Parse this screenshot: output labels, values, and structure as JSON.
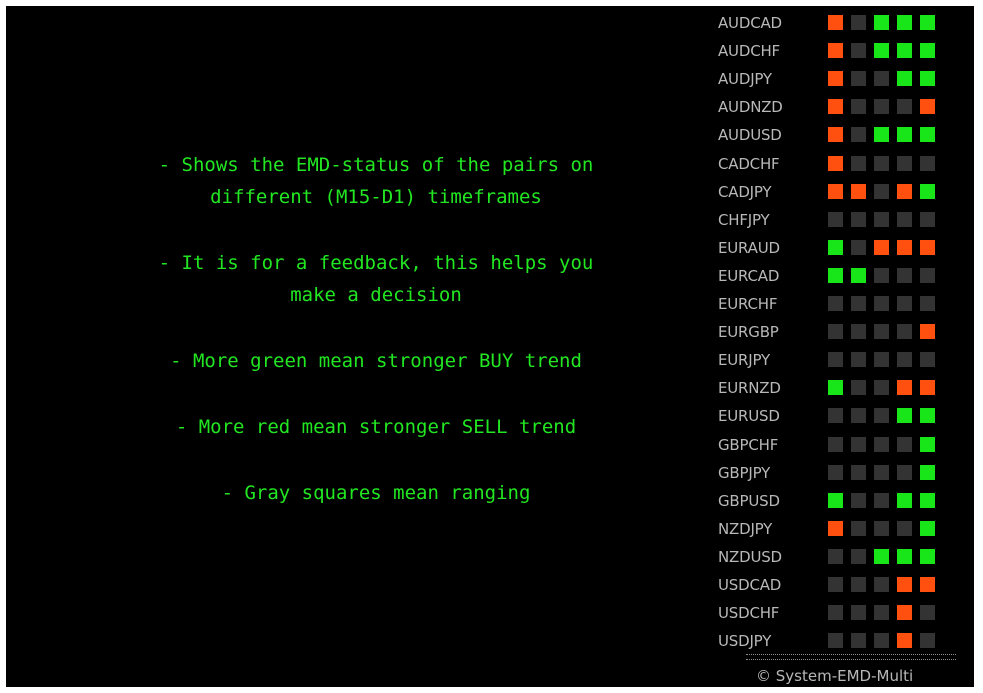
{
  "info_lines": [
    "- Shows the EMD-status of the pairs on\ndifferent (M15-D1) timeframes",
    "- It is for a feedback, this helps you\nmake a decision",
    "- More green mean stronger BUY trend",
    "- More red mean stronger SELL trend",
    "- Gray squares mean ranging"
  ],
  "colors": {
    "green": "#19e619",
    "red": "#ff5010",
    "gray": "#333333",
    "text_green": "#22e622"
  },
  "pairs": [
    {
      "symbol": "AUDCAD",
      "status": [
        "red",
        "gray",
        "green",
        "green",
        "green"
      ]
    },
    {
      "symbol": "AUDCHF",
      "status": [
        "red",
        "gray",
        "green",
        "green",
        "green"
      ]
    },
    {
      "symbol": "AUDJPY",
      "status": [
        "red",
        "gray",
        "gray",
        "green",
        "green"
      ]
    },
    {
      "symbol": "AUDNZD",
      "status": [
        "red",
        "gray",
        "gray",
        "gray",
        "red"
      ]
    },
    {
      "symbol": "AUDUSD",
      "status": [
        "red",
        "gray",
        "green",
        "green",
        "green"
      ]
    },
    {
      "symbol": "CADCHF",
      "status": [
        "red",
        "gray",
        "gray",
        "gray",
        "gray"
      ]
    },
    {
      "symbol": "CADJPY",
      "status": [
        "red",
        "red",
        "gray",
        "red",
        "green"
      ]
    },
    {
      "symbol": "CHFJPY",
      "status": [
        "gray",
        "gray",
        "gray",
        "gray",
        "gray"
      ]
    },
    {
      "symbol": "EURAUD",
      "status": [
        "green",
        "gray",
        "red",
        "red",
        "red"
      ]
    },
    {
      "symbol": "EURCAD",
      "status": [
        "green",
        "green",
        "gray",
        "gray",
        "gray"
      ]
    },
    {
      "symbol": "EURCHF",
      "status": [
        "gray",
        "gray",
        "gray",
        "gray",
        "gray"
      ]
    },
    {
      "symbol": "EURGBP",
      "status": [
        "gray",
        "gray",
        "gray",
        "gray",
        "red"
      ]
    },
    {
      "symbol": "EURJPY",
      "status": [
        "gray",
        "gray",
        "gray",
        "gray",
        "gray"
      ]
    },
    {
      "symbol": "EURNZD",
      "status": [
        "green",
        "gray",
        "gray",
        "red",
        "red"
      ]
    },
    {
      "symbol": "EURUSD",
      "status": [
        "gray",
        "gray",
        "gray",
        "green",
        "green"
      ]
    },
    {
      "symbol": "GBPCHF",
      "status": [
        "gray",
        "gray",
        "gray",
        "gray",
        "green"
      ]
    },
    {
      "symbol": "GBPJPY",
      "status": [
        "gray",
        "gray",
        "gray",
        "gray",
        "green"
      ]
    },
    {
      "symbol": "GBPUSD",
      "status": [
        "green",
        "gray",
        "gray",
        "green",
        "green"
      ]
    },
    {
      "symbol": "NZDJPY",
      "status": [
        "red",
        "gray",
        "gray",
        "gray",
        "green"
      ]
    },
    {
      "symbol": "NZDUSD",
      "status": [
        "gray",
        "gray",
        "green",
        "green",
        "green"
      ]
    },
    {
      "symbol": "USDCAD",
      "status": [
        "gray",
        "gray",
        "gray",
        "red",
        "red"
      ]
    },
    {
      "symbol": "USDCHF",
      "status": [
        "gray",
        "gray",
        "gray",
        "red",
        "gray"
      ]
    },
    {
      "symbol": "USDJPY",
      "status": [
        "gray",
        "gray",
        "gray",
        "red",
        "gray"
      ]
    }
  ],
  "separator": "=========================",
  "footer": "© System-EMD-Multi"
}
